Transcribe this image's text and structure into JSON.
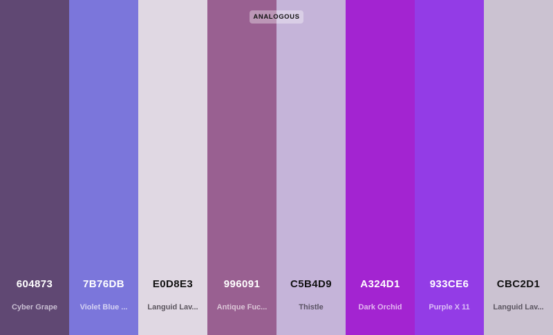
{
  "scheme": {
    "label": "ANALOGOUS"
  },
  "swatches": [
    {
      "hex": "604873",
      "name": "Cyber Grape",
      "bg": "#604873",
      "hex_color": "#ffffff",
      "name_color": "#c9bfd3"
    },
    {
      "hex": "7B76DB",
      "name": "Violet Blue ...",
      "bg": "#7B76DB",
      "hex_color": "#ffffff",
      "name_color": "#d6d3f3"
    },
    {
      "hex": "E0D8E3",
      "name": "Languid Lav...",
      "bg": "#E0D8E3",
      "hex_color": "#111111",
      "name_color": "#5c565f"
    },
    {
      "hex": "996091",
      "name": "Antique Fuc...",
      "bg": "#996091",
      "hex_color": "#ffffff",
      "name_color": "#dcc7d8"
    },
    {
      "hex": "C5B4D9",
      "name": "Thistle",
      "bg": "#C5B4D9",
      "hex_color": "#111111",
      "name_color": "#5a5263"
    },
    {
      "hex": "A324D1",
      "name": "Dark Orchid",
      "bg": "#A324D1",
      "hex_color": "#ffffff",
      "name_color": "#e3b9f1"
    },
    {
      "hex": "933CE6",
      "name": "Purple X 11",
      "bg": "#933CE6",
      "hex_color": "#ffffff",
      "name_color": "#dcc0f6"
    },
    {
      "hex": "CBC2D1",
      "name": "Languid Lav...",
      "bg": "#CBC2D1",
      "hex_color": "#111111",
      "name_color": "#5b5560"
    }
  ]
}
